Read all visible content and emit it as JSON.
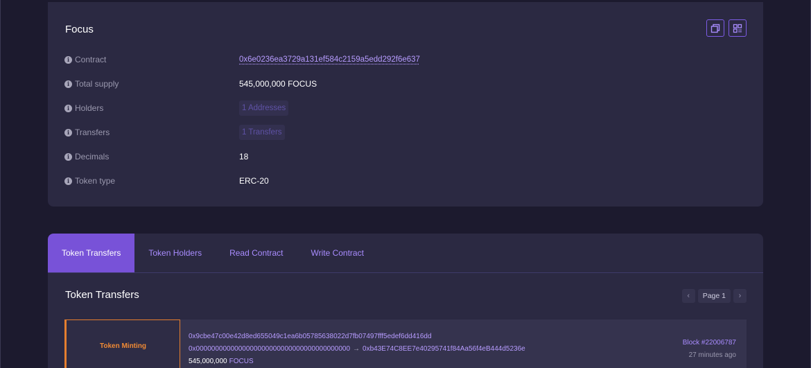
{
  "token": {
    "title": "Focus",
    "details": [
      {
        "label": "Contract",
        "value": "0x6e0236ea3729a131ef584c2159a5edd292f6e637",
        "kind": "link"
      },
      {
        "label": "Total supply",
        "value": "545,000,000 FOCUS",
        "kind": "text"
      },
      {
        "label": "Holders",
        "value": "1 Addresses",
        "kind": "badge"
      },
      {
        "label": "Transfers",
        "value": "1 Transfers",
        "kind": "badge"
      },
      {
        "label": "Decimals",
        "value": "18",
        "kind": "text"
      },
      {
        "label": "Token type",
        "value": "ERC-20",
        "kind": "text"
      }
    ]
  },
  "icons": {
    "copy": "copy-icon",
    "qr": "qr-code-icon",
    "info": "info-icon",
    "prev": "chevron-left-icon",
    "next": "chevron-right-icon"
  },
  "colors": {
    "accent": "#7852d8",
    "link": "#b79cff",
    "minting": "#f08a34",
    "panel": "#2b2942",
    "background": "#1c1a2e"
  },
  "tabs": [
    {
      "label": "Token Transfers",
      "active": true
    },
    {
      "label": "Token Holders",
      "active": false
    },
    {
      "label": "Read Contract",
      "active": false
    },
    {
      "label": "Write Contract",
      "active": false
    }
  ],
  "transfers": {
    "title": "Token Transfers",
    "pager": {
      "prev": "‹",
      "page": "Page 1",
      "next": "›"
    },
    "rows": [
      {
        "type": "Token Minting",
        "hash": "0x9cbe47c00e42d8ed655049c1ea6b05785638022d7fb07497fff5edef6dd416dd",
        "from": "0x0000000000000000000000000000000000000000",
        "arrow": "→",
        "to": "0xb43E74C8EE7e40295741f84Aa56f4eB444d5236e",
        "amount": "545,000,000",
        "token": "FOCUS",
        "block": "Block #22006787",
        "time": "27 minutes ago"
      }
    ]
  }
}
